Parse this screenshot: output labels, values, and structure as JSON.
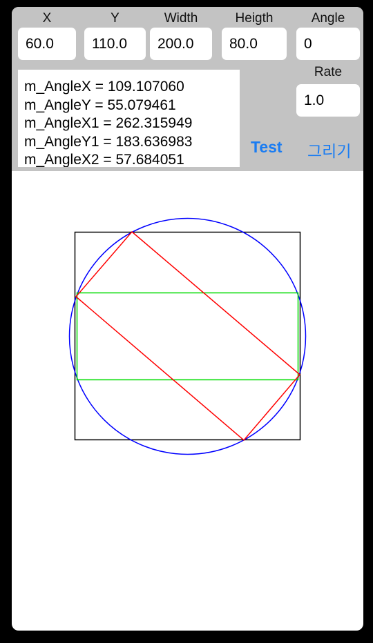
{
  "fields": {
    "x": {
      "label": "X",
      "value": "60.0"
    },
    "y": {
      "label": "Y",
      "value": "110.0"
    },
    "width": {
      "label": "Width",
      "value": "200.0"
    },
    "height": {
      "label": "Heigth",
      "value": "80.0"
    },
    "angle": {
      "label": "Angle",
      "value": "0"
    },
    "rate": {
      "label": "Rate",
      "value": "1.0"
    }
  },
  "log": {
    "lines": [
      "m_AngleX = 109.107060",
      "m_AngleY = 55.079461",
      "m_AngleX1 = 262.315949",
      "m_AngleY1 = 183.636983",
      "m_AngleX2 = 57.684051"
    ]
  },
  "buttons": {
    "test_label": "Test",
    "draw_label": "그리기"
  },
  "drawing": {
    "colors": {
      "bounding_box": "#000000",
      "circle": "#0000ff",
      "rotated_rect": "#ff0000",
      "rect": "#00dd00"
    }
  },
  "colors": {
    "panel_background": "#c3c3c3",
    "accent": "#1a7cf2"
  }
}
